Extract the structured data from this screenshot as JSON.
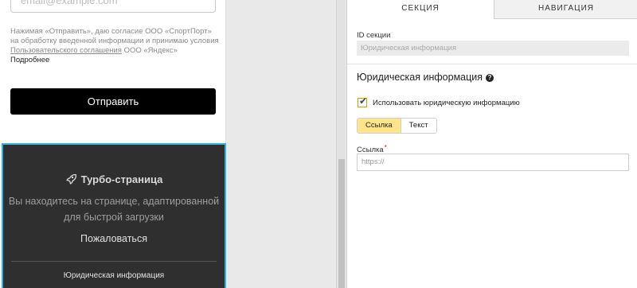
{
  "preview": {
    "email_placeholder": "email@example.com",
    "consent_text": "Нажимая «Отправить», даю согласие ООО «СпортПорт» на обработку введенной информации и принимаю условия ",
    "consent_link": "Пользовательского соглашения",
    "consent_tail": " ООО «Яндекс»",
    "consent_more": "Подробнее",
    "submit_label": "Отправить",
    "turbo": {
      "title": "Турбо-страница",
      "desc_line1": "Вы находитесь на странице, адаптированной",
      "desc_line2": "для быстрой загрузки",
      "complain": "Пожаловаться",
      "legal": "Юридическая информация"
    }
  },
  "panel": {
    "tabs": [
      "СЕКЦИЯ",
      "НАВИГАЦИЯ"
    ],
    "id_label": "ID секции",
    "id_value": "Юридическая информация",
    "section_title": "Юридическая информация",
    "help_glyph": "?",
    "checkbox_label": "Использовать юридическую информацию",
    "checkbox_checked": true,
    "segments": [
      "Ссылка",
      "Текст"
    ],
    "active_segment": "Ссылка",
    "link_label": "Ссылка",
    "required_mark": "*",
    "link_placeholder": "https://"
  },
  "colors": {
    "turbo_bg": "#2f2f2f",
    "turbo_border": "#2bb5d6",
    "active_segment": "#ffe58a",
    "submit_bg": "#000000"
  }
}
